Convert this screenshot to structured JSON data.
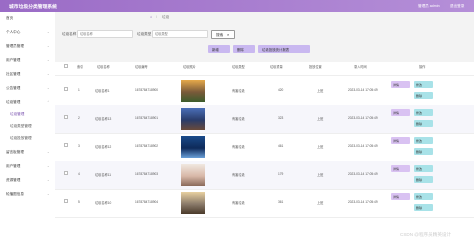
{
  "app": {
    "title": "城市垃圾分类管理系统",
    "user": "管理员 admin",
    "exit": "退出登录"
  },
  "sidebar": {
    "items": [
      {
        "label": "首页",
        "chev": ""
      },
      {
        "label": "个人中心",
        "chev": "⌄"
      },
      {
        "label": "管理员管理",
        "chev": "⌄"
      },
      {
        "label": "用户管理",
        "chev": "⌄"
      },
      {
        "label": "社区管理",
        "chev": "⌄"
      },
      {
        "label": "公告管理",
        "chev": "⌄"
      },
      {
        "label": "垃圾管理",
        "chev": "⌃"
      },
      {
        "label": "垃圾管理",
        "chev": ""
      },
      {
        "label": "垃圾类型管理",
        "chev": ""
      },
      {
        "label": "垃圾投放管理",
        "chev": ""
      },
      {
        "label": "留言板管理",
        "chev": "⌄"
      },
      {
        "label": "用户管理",
        "chev": "⌄"
      },
      {
        "label": "资源管理",
        "chev": "⌄"
      },
      {
        "label": "轮播图信息",
        "chev": "⌄"
      }
    ]
  },
  "breadcrumb": {
    "home": "⌂",
    "sep": "/",
    "current": "垃圾"
  },
  "filters": {
    "name_label": "垃圾名称",
    "name_placeholder": "垃圾名称",
    "type_label": "垃圾类型",
    "type_placeholder": "垃圾类型",
    "search_label": "搜索",
    "search_icon": "⌕"
  },
  "actions": {
    "add": "新增",
    "delete": "删除",
    "stats": "垃圾投放统计报表"
  },
  "table": {
    "headers": [
      "索引",
      "垃圾名称",
      "垃圾编号",
      "垃圾照片",
      "垃圾类型",
      "垃圾重量",
      "投放位置",
      "录入时间",
      "操作"
    ],
    "rows": [
      {
        "index": "1",
        "name": "垃圾名称1",
        "code": "1678784718900",
        "type": "有害垃圾",
        "weight": "420",
        "pos": "上班",
        "time": "2023-03-14 17:05:49",
        "photo_colors": [
          "#e6a94a",
          "#7a5a3a",
          "#3c5c2c"
        ]
      },
      {
        "index": "2",
        "name": "垃圾名称13",
        "code": "1678784718901",
        "type": "有害垃圾",
        "weight": "323",
        "pos": "上班",
        "time": "2023-03-14 17:05:49",
        "photo_colors": [
          "#4a6fb8",
          "#2a3c6a",
          "#6a4a3a"
        ]
      },
      {
        "index": "3",
        "name": "垃圾名称12",
        "code": "1678784718902",
        "type": "有害垃圾",
        "weight": "461",
        "pos": "上班",
        "time": "2023-03-14 17:05:49",
        "photo_colors": [
          "#1a4a8a",
          "#0e2a5a",
          "#6aa0d8"
        ]
      },
      {
        "index": "4",
        "name": "垃圾名称11",
        "code": "1678784718903",
        "type": "有害垃圾",
        "weight": "179",
        "pos": "上班",
        "time": "2023-03-14 17:05:49",
        "photo_colors": [
          "#f0e8e0",
          "#d8b8a8",
          "#8a6a5a"
        ]
      },
      {
        "index": "5",
        "name": "垃圾名称10",
        "code": "1678784718904",
        "type": "有害垃圾",
        "weight": "361",
        "pos": "上班",
        "time": "2023-03-14 17:05:49",
        "photo_colors": [
          "#e8d0a0",
          "#8a7a6a",
          "#4a3a2a"
        ]
      }
    ],
    "btn_detail": "详情",
    "btn_edit": "修改",
    "btn_delete": "删除"
  },
  "watermark": "CSDN @程序员精英设计"
}
